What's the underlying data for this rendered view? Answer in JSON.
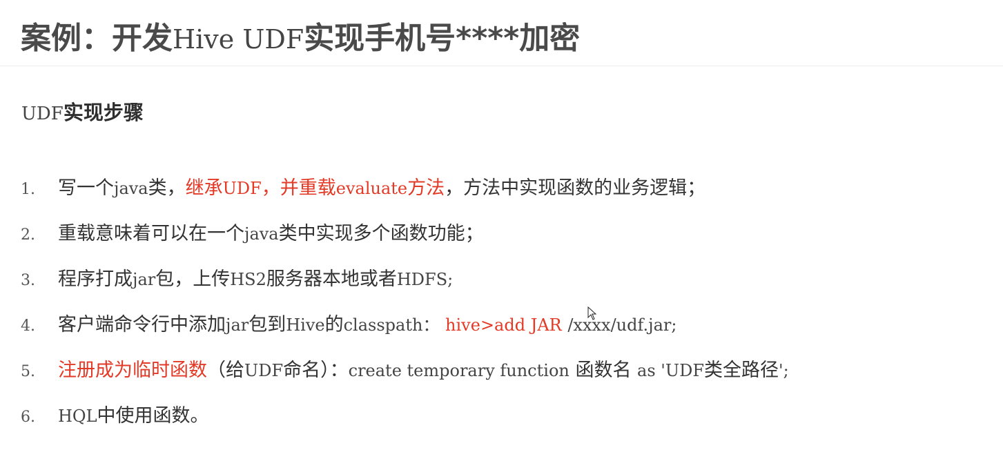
{
  "header": {
    "title_part1": "案例：开发",
    "title_part2": "Hive UDF",
    "title_part3": "实现手机号****加密"
  },
  "section": {
    "heading_part1": "UDF",
    "heading_part2": "实现步骤"
  },
  "steps": [
    {
      "num": "1.",
      "seg1": "写一个",
      "seg2": "java",
      "seg3": "类，",
      "seg4": "继承",
      "seg5": "UDF",
      "seg6": "，并重载",
      "seg7": "evaluate",
      "seg8": "方法",
      "seg9": "，方法中实现函数的业务逻辑；"
    },
    {
      "num": "2.",
      "seg1": "重载意味着可以在一个",
      "seg2": "java",
      "seg3": "类中实现多个函数功能；"
    },
    {
      "num": "3.",
      "seg1": "程序打成",
      "seg2": "jar",
      "seg3": "包，上传",
      "seg4": "HS2",
      "seg5": "服务器本地或者",
      "seg6": "HDFS;"
    },
    {
      "num": "4.",
      "seg1": "客户端命令行中添加",
      "seg2": "jar",
      "seg3": "包到",
      "seg4": "Hive",
      "seg5": "的",
      "seg6": "classpath：",
      "seg7": "hive>add JAR",
      "seg8": "/xxxx/udf.jar;"
    },
    {
      "num": "5.",
      "seg1": "注册成为临时函数",
      "seg2": "（给",
      "seg3": "UDF",
      "seg4": "命名）：",
      "seg5": "create temporary function",
      "seg6": "函数名",
      "seg7": "as 'UDF",
      "seg8": "类全路径",
      "seg9": "';"
    },
    {
      "num": "6.",
      "seg1": "HQL",
      "seg2": "中使用函数。"
    }
  ]
}
